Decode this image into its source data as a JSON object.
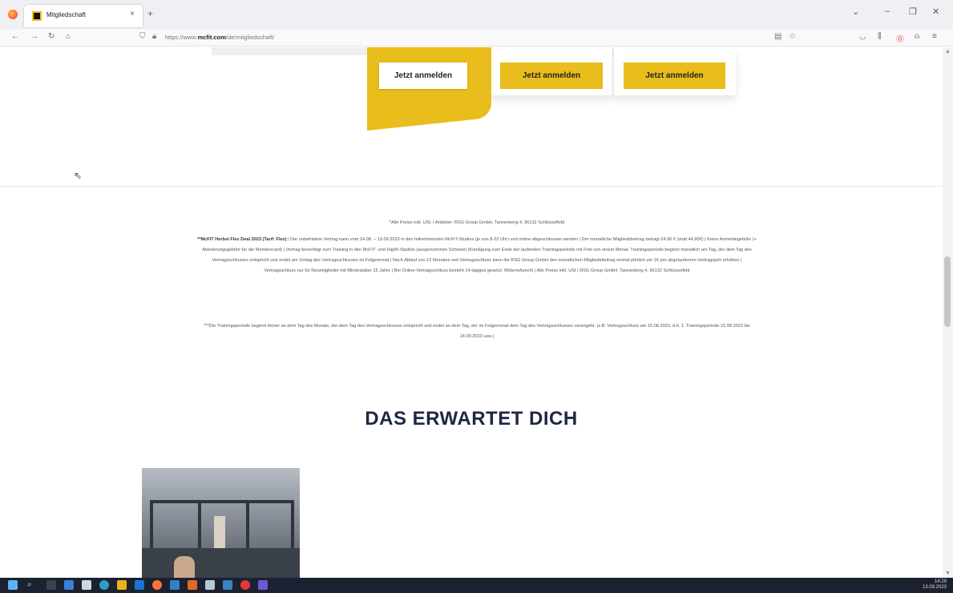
{
  "browser": {
    "tab_title": "Mitgliedschaft",
    "tab_close": "×",
    "new_tab": "+",
    "url_prefix": "https://www.",
    "url_host": "mcfit.com",
    "url_path": "/de/mitgliedschaft/"
  },
  "page": {
    "cta_buttons": [
      "Jetzt anmelden",
      "Jetzt anmelden",
      "Jetzt anmelden"
    ],
    "footnote_1": "*Alle Preise inkl. USt. | Anbieter: RSG Group GmbH, Tannenberg 4, 96132 Schlüsselfeld",
    "footnote_2_bold": "**McFIT Herbst Flex Deal 2023 (Tarif: Flex)",
    "footnote_2": " | Der unbefristete Vertrag kann vom 24.08. – 19.09.2023 in den teilnehmenden McFIT-Studios (je von 8-22 Uhr) und online abgeschlossen werden | Der monatliche Mitgliedsbeitrag beträgt 24,90 € (statt 44,90€) | Keine Anmeldegebühr (+ Aktivierungsgebühr für die Membercard) | Vertrag berechtigt zum Training in den McFIT- und High5-Studios (ausgenommen Schweiz) |Kündigung zum Ende der laufenden Trainingsperiode mit Frist von einem Monat. Trainingsperiode beginnt monatlich am Tag, der dem Tag des Vertragsschlusses entspricht und endet am Vortag des Vertragsschlusses im Folgemonat | Nach Ablauf von 12 Monaten seit Vertragsschluss kann die RSG Group GmbH den monatlichen Mitgliedsbeitrag einmal jährlich um 1€ pro abgelaufenem Vertragsjahr erhöhen | Vertragsschluss nur für Neumitglieder mit Mindestalter 15 Jahre | Bei Online-Vertragsschluss besteht 14-tägiges gesetzl. Widerrufsrecht | Alle Preise inkl. USt | RSG Group GmbH, Tannenberg 4, 96132 Schlüsselfeld",
    "footnote_3": "***Die Trainingsperiode beginnt immer an dem Tag des Monats, der dem Tag des Vertragsschlusses entspricht und endet an dem Tag, der im Folgemonat dem Tag des Vertragsschlusses vorangeht. (z.B. Vertragsschluss am 15.08.2023, d.h. 1. Trainingsperiode 15.08.2023 bis 14.09.2023 usw.)",
    "section_title": "DAS ERWARTET DICH"
  },
  "taskbar": {
    "time": "14:29",
    "date": "13.09.2023"
  },
  "colors": {
    "brand_yellow": "#e9bd1b",
    "heading_navy": "#1e2743",
    "taskbar": "#1b2130"
  }
}
